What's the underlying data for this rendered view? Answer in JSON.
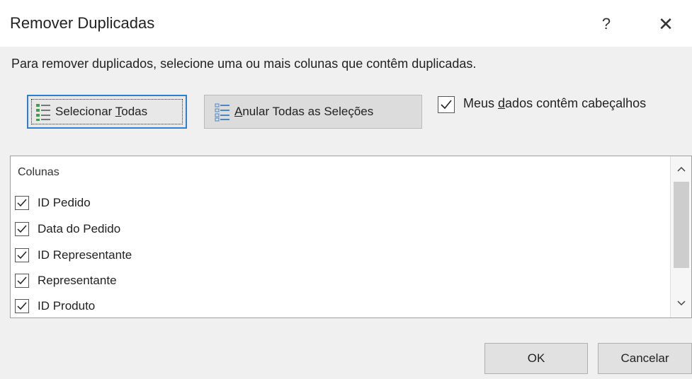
{
  "dialog": {
    "title": "Remover Duplicadas",
    "help_label": "?",
    "close_label": "✕"
  },
  "instruction": "Para remover duplicados, selecione uma ou mais colunas que contêm duplicadas.",
  "buttons": {
    "select_all_label": "Selecionar ",
    "select_all_mnemonic": "T",
    "select_all_rest": "odas",
    "clear_all_mnemonic": "A",
    "clear_all_rest": "nular Todas as Seleções",
    "ok_label": "OK",
    "cancel_label": "Cancelar"
  },
  "header_option": {
    "label_pre": "Meus ",
    "label_mnemonic": "d",
    "label_post": "ados contêm cabeçalhos",
    "checked": true
  },
  "columns": {
    "header": "Colunas",
    "items": [
      {
        "label": "ID Pedido",
        "checked": true
      },
      {
        "label": "Data do Pedido",
        "checked": true
      },
      {
        "label": "ID Representante",
        "checked": true
      },
      {
        "label": "Representante",
        "checked": true
      },
      {
        "label": "ID Produto",
        "checked": true
      }
    ]
  },
  "icons": {
    "select_all": "list-select-all-icon",
    "clear_all": "list-clear-all-icon",
    "check": "checkmark-icon",
    "scroll_up": "chevron-up-icon",
    "scroll_down": "chevron-down-icon"
  },
  "colors": {
    "focus_border": "#2d7fd0",
    "select_icon_green": "#3aa34a",
    "clear_icon_blue": "#4a86c8"
  }
}
